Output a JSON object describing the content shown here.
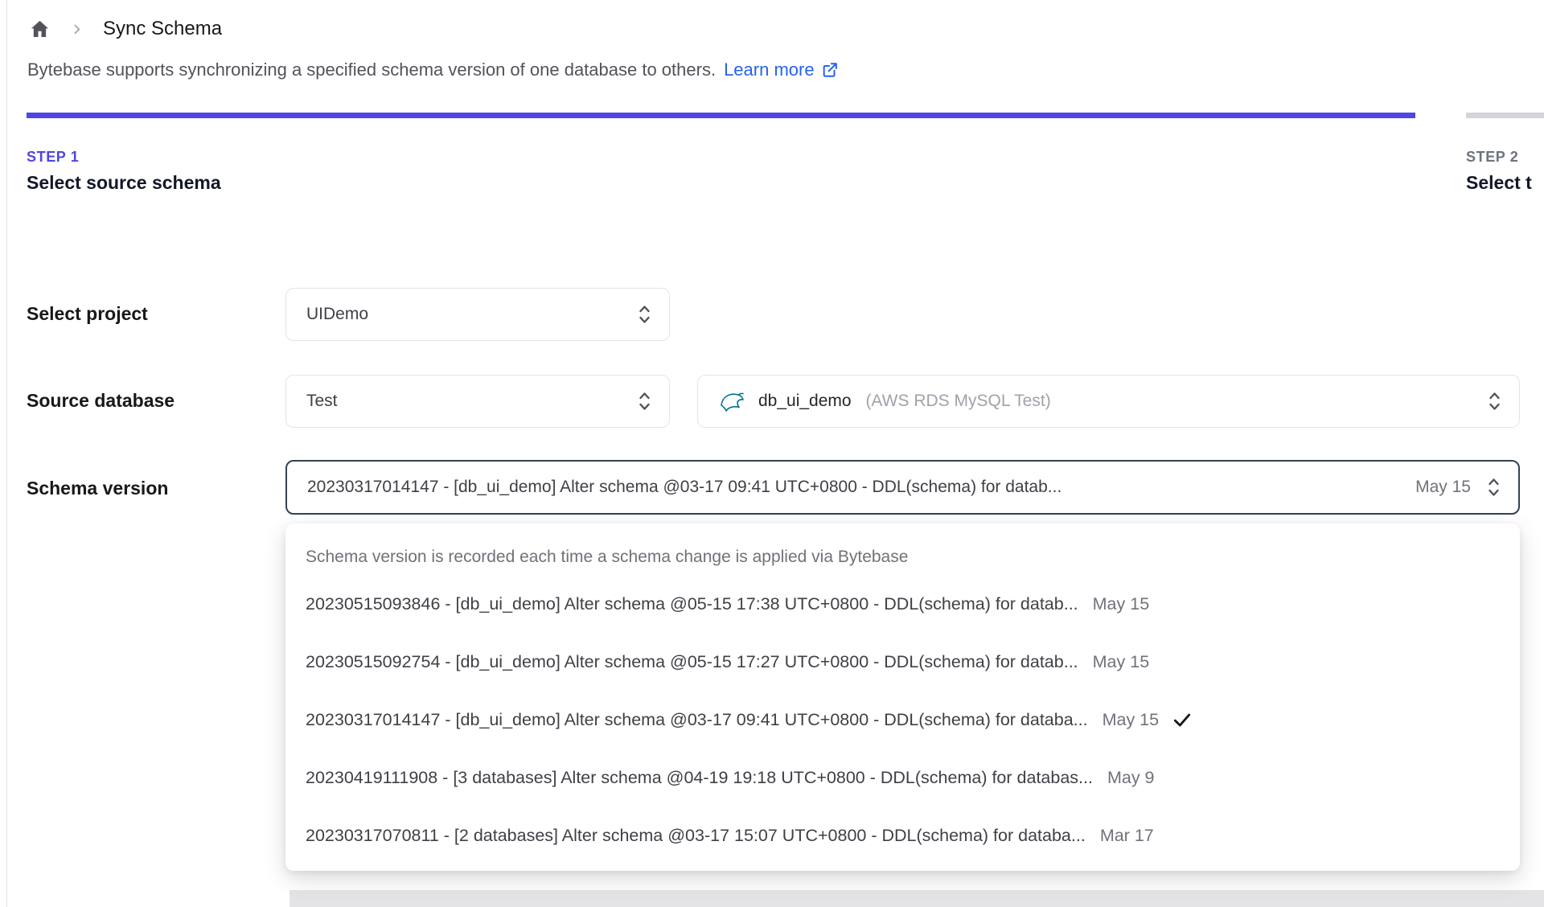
{
  "breadcrumb": {
    "page_title": "Sync Schema"
  },
  "description": {
    "text": "Bytebase supports synchronizing a specified schema version of one database to others.",
    "link_label": "Learn more"
  },
  "steps": [
    {
      "label": "STEP 1",
      "title": "Select source schema",
      "active": true
    },
    {
      "label": "STEP 2",
      "title": "Select t",
      "active": false
    }
  ],
  "form": {
    "project": {
      "label": "Select project",
      "value": "UIDemo"
    },
    "source_database": {
      "label": "Source database",
      "environment_value": "Test",
      "database_name": "db_ui_demo",
      "database_detail": "(AWS RDS MySQL Test)",
      "database_icon": "mysql-icon"
    },
    "schema_version": {
      "label": "Schema version",
      "value": "20230317014147 - [db_ui_demo] Alter schema @03-17 09:41 UTC+0800 - DDL(schema) for datab...",
      "date": "May 15"
    }
  },
  "dropdown": {
    "header": "Schema version is recorded each time a schema change is applied via Bytebase",
    "options": [
      {
        "label": "20230515093846 - [db_ui_demo] Alter schema @05-15 17:38 UTC+0800 - DDL(schema) for datab...",
        "date": "May 15",
        "selected": false
      },
      {
        "label": "20230515092754 - [db_ui_demo] Alter schema @05-15 17:27 UTC+0800 - DDL(schema) for datab...",
        "date": "May 15",
        "selected": false
      },
      {
        "label": "20230317014147 - [db_ui_demo] Alter schema @03-17 09:41 UTC+0800 - DDL(schema) for databa...",
        "date": "May 15",
        "selected": true
      },
      {
        "label": "20230419111908 - [3 databases] Alter schema @04-19 19:18 UTC+0800 - DDL(schema) for databas...",
        "date": "May 9",
        "selected": false
      },
      {
        "label": "20230317070811 - [2 databases] Alter schema @03-17 15:07 UTC+0800 - DDL(schema) for databa...",
        "date": "Mar 17",
        "selected": false
      }
    ]
  },
  "colors": {
    "accent": "#4f46e5",
    "link": "#2563eb",
    "inactive_bar": "#d4d4d8",
    "focus_border": "#374151",
    "mysql_teal": "#00758f"
  }
}
